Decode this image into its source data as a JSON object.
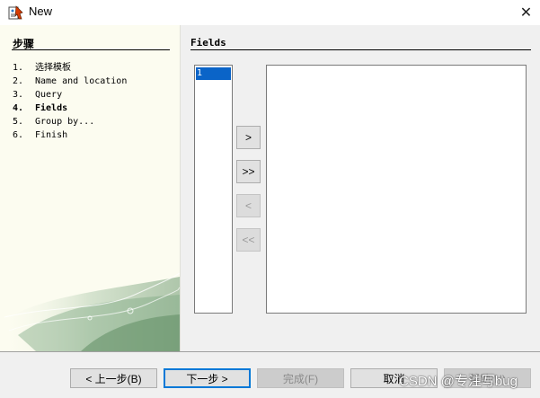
{
  "window": {
    "title": "New",
    "close_glyph": "✕",
    "app_icon": "wizard-app-icon"
  },
  "steps": {
    "heading": "步骤",
    "items": [
      {
        "num": "1.",
        "label": "选择模板"
      },
      {
        "num": "2.",
        "label": "Name and location"
      },
      {
        "num": "3.",
        "label": "Query"
      },
      {
        "num": "4.",
        "label": "Fields",
        "current": true
      },
      {
        "num": "5.",
        "label": "Group by..."
      },
      {
        "num": "6.",
        "label": "Finish"
      }
    ]
  },
  "fields": {
    "heading": "Fields",
    "available_items": [
      "1"
    ],
    "selected_items": [],
    "move_buttons": {
      "add": ">",
      "add_all": ">>",
      "remove": "<",
      "remove_all": "<<"
    }
  },
  "footer": {
    "back": "< 上一步(B)",
    "next": "下一步 >",
    "finish": "完成(F)",
    "cancel": "取消",
    "help": "帮助(H)",
    "watermark": "CSDN @专注写bug"
  },
  "colors": {
    "selection": "#0a64c8",
    "left_pane_bg": "#fcfcf0",
    "dialog_bg": "#f0f0f0",
    "default_button_border": "#0078d7"
  }
}
